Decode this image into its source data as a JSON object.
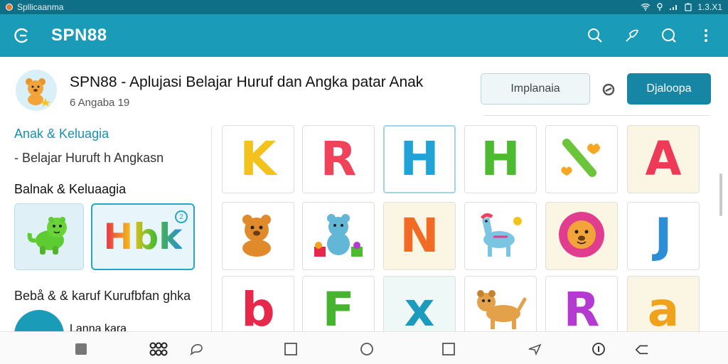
{
  "status_bar": {
    "app_label": "Spllicaanma",
    "time": "1.3.X1"
  },
  "app_bar": {
    "title": "SPN88"
  },
  "header": {
    "title": "SPN88 - Aplujasi Belajar Huruf dan Angka patar Anak",
    "subtitle": "6 Angaba 19",
    "secondary_button": "Implanaia",
    "primary_button": "Djaloopa"
  },
  "sidebar": {
    "link": "Anak & Keluagia",
    "text": "- Belajar Huruft h Angkasn",
    "heading": "Balnak & Keluaagia",
    "card2_text": "Hbk",
    "card2_badge": "2",
    "bottom_heading": "Bebå & & karuf Kurufbfan ghka",
    "last_item": "Lanna kara"
  },
  "tiles": [
    {
      "char": "K",
      "color": "#f4c21c",
      "bg": "#ffffff",
      "kind": "letter"
    },
    {
      "char": "R",
      "color": "#f0435a",
      "bg": "#ffffff",
      "kind": "letter"
    },
    {
      "char": "H",
      "color": "#22a3d8",
      "bg": "#ffffff",
      "kind": "letter",
      "selected": true
    },
    {
      "char": "H",
      "color": "#4cbb2f",
      "bg": "#ffffff",
      "kind": "letter"
    },
    {
      "char": "",
      "color": "#6cc43a",
      "bg": "#ffffff",
      "kind": "slash"
    },
    {
      "char": "A",
      "color": "#ee3a56",
      "bg": "#fbf6e4",
      "kind": "letter"
    },
    {
      "char": "",
      "color": "#e08a2c",
      "bg": "#ffffff",
      "kind": "bear"
    },
    {
      "char": "",
      "color": "#62b6d6",
      "bg": "#ffffff",
      "kind": "bear-blue"
    },
    {
      "char": "N",
      "color": "#f26b25",
      "bg": "#fbf6e4",
      "kind": "letter"
    },
    {
      "char": "",
      "color": "#7ac6e2",
      "bg": "#ffffff",
      "kind": "horse"
    },
    {
      "char": "",
      "color": "#e13d8e",
      "bg": "#fbf6e4",
      "kind": "lion"
    },
    {
      "char": "J",
      "color": "#2b8ed6",
      "bg": "#ffffff",
      "kind": "letter"
    },
    {
      "char": "b",
      "color": "#e8284a",
      "bg": "#ffffff",
      "kind": "letter"
    },
    {
      "char": "F",
      "color": "#47b42f",
      "bg": "#ffffff",
      "kind": "letter"
    },
    {
      "char": "x",
      "color": "#1c9bbd",
      "bg": "#eef8f7",
      "kind": "letter"
    },
    {
      "char": "",
      "color": "#e3a14a",
      "bg": "#ffffff",
      "kind": "dog"
    },
    {
      "char": "R",
      "color": "#b43ad1",
      "bg": "#ffffff",
      "kind": "letter"
    },
    {
      "char": "a",
      "color": "#f0a21a",
      "bg": "#fbf6e4",
      "kind": "letter"
    }
  ],
  "colors": {
    "primary": "#1a9bb8",
    "status": "#0f6f86",
    "accent_button": "#1686a4"
  },
  "icons": {
    "app_bar": [
      "back-circle-icon",
      "search-icon",
      "bird-icon",
      "search-icon",
      "more-vert-icon"
    ],
    "nav": [
      "square-filled-icon",
      "apps-grid-icon",
      "chat-icon",
      "square-icon",
      "circle-icon",
      "square-icon",
      "send-icon",
      "info-icon",
      "back-arrow-icon"
    ]
  }
}
